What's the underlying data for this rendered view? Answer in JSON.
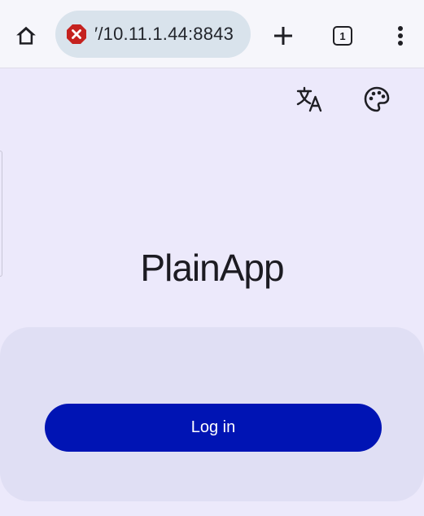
{
  "browser": {
    "url": "′/10.11.1.44:8843",
    "tab_count": "1",
    "icons": {
      "home": "home-icon",
      "insecure": "not-secure-icon",
      "new_tab": "plus-icon",
      "tabs": "tab-switcher-icon",
      "menu": "more-vert-icon"
    },
    "colors": {
      "insecure": "#c5221f",
      "url_pill": "#d9e3ec"
    }
  },
  "page": {
    "toolbar_icons": {
      "language": "translate-icon",
      "theme": "palette-icon"
    },
    "title": "PlainApp",
    "login": {
      "button_label": "Log in"
    },
    "colors": {
      "background": "#ece9fb",
      "card": "#e0dff4",
      "button": "#0014b4"
    }
  }
}
